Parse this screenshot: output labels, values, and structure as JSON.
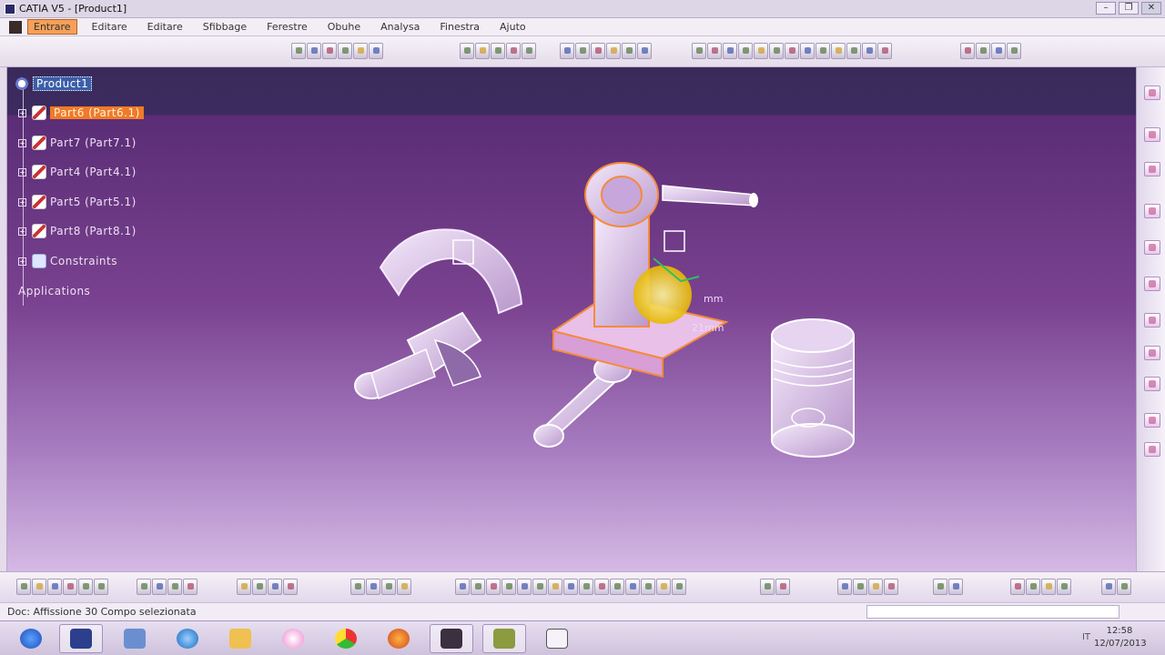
{
  "window": {
    "title": "CATIA V5 - [Product1]",
    "controls": [
      "minimize",
      "restore",
      "close"
    ]
  },
  "menu": {
    "items": [
      "Entrare",
      "Editare",
      "Editare",
      "Sfibbage",
      "Ferestre",
      "Obuhe",
      "Analysa",
      "Finestra",
      "Ajuto"
    ],
    "right_label": ""
  },
  "tree": {
    "root": "Product1",
    "children": [
      {
        "label": "Part6 (Part6.1)",
        "selected": true
      },
      {
        "label": "Part7 (Part7.1)",
        "selected": false
      },
      {
        "label": "Part4 (Part4.1)",
        "selected": false
      },
      {
        "label": "Part5 (Part5.1)",
        "selected": false
      },
      {
        "label": "Part8 (Part8.1)",
        "selected": false
      }
    ],
    "constraints": "Constraints",
    "applications": "Applications"
  },
  "annotations": {
    "dimension_1": "mm",
    "dimension_2": "21mm"
  },
  "status": {
    "text": "Doc: Affissione 30 Compo selezionata",
    "input_value": ""
  },
  "taskbar": {
    "apps": [
      "start-button",
      "catia-icon",
      "network-icon",
      "ie-icon",
      "folder-icon",
      "media-icon",
      "chrome-icon",
      "firefox-icon",
      "film-icon",
      "photo-icon",
      "file-icon"
    ],
    "tray": "IT",
    "clock_time": "12:58",
    "clock_date": "12/07/2013"
  },
  "colors": {
    "viewport_top": "#3d2b60",
    "viewport_bottom": "#d5b9e4",
    "selection": "#f07a28",
    "root_highlight": "#3c5ea8"
  }
}
